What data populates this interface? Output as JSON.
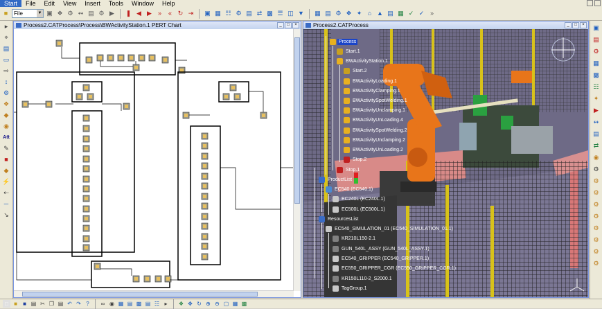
{
  "menu": {
    "items": [
      "Start",
      "File",
      "Edit",
      "View",
      "Insert",
      "Tools",
      "Window",
      "Help"
    ]
  },
  "toolbar": {
    "file_combo": "File"
  },
  "left_toolbar": {
    "att_label": "Att"
  },
  "pert_window": {
    "title": "Process2.CATProcess\\Process\\BWActivityStation.1 PERT Chart"
  },
  "sim_window": {
    "title": "Process2.CATProcess"
  },
  "tree": {
    "nodes": [
      {
        "label": "Process",
        "selected": true
      },
      {
        "label": "Start.1"
      },
      {
        "label": "BWActivityStation.1"
      },
      {
        "label": "Start.2"
      },
      {
        "label": "BWActivityLoading.1"
      },
      {
        "label": "BWActivityClamping.1"
      },
      {
        "label": "BWActivitySpotWelding.1"
      },
      {
        "label": "BWActivityUnclamping.1"
      },
      {
        "label": "BWActivityUnLoading.4"
      },
      {
        "label": "BWActivitySpotWelding.2"
      },
      {
        "label": "BWActivityUnclamping.2"
      },
      {
        "label": "BWActivityUnLoading.2"
      },
      {
        "label": "Stop.2"
      },
      {
        "label": "Stop.1"
      },
      {
        "label": "ProductList"
      },
      {
        "label": "EC540 (EC540.1)"
      },
      {
        "label": "EC240L (EC240L.1)"
      },
      {
        "label": "EC500L (EC500L.1)"
      },
      {
        "label": "ResourcesList"
      },
      {
        "label": "EC540_SIMULATION_01 (EC540_SIMULATION_01.1)"
      },
      {
        "label": "KR210L150-2.1"
      },
      {
        "label": "GUN_540L_ASSY (GUN_540L_ASSY.1)"
      },
      {
        "label": "EC540_GRIPPER (EC540_GRIPPER.1)"
      },
      {
        "label": "EC550_GRIPPER_CGR (EC550_GRIPPER_CGR.1)"
      },
      {
        "label": "KR150L110-2_S2000.1"
      },
      {
        "label": "TagGroup.1"
      }
    ]
  },
  "colors": {
    "selection": "#1a44c8",
    "robot": "#e8751a",
    "floor": "#6e6a86",
    "fence": "#1e1e1e",
    "fence_post": "#d8c21a"
  }
}
